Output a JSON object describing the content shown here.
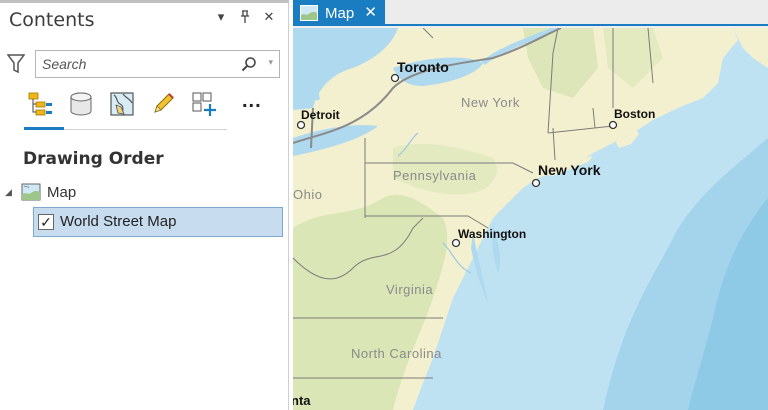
{
  "contents_pane": {
    "title": "Contents",
    "controls": {
      "options_glyph": "▾",
      "pin_glyph": "⊥",
      "close_glyph": "✕"
    },
    "filter_icon": "filter-icon",
    "search": {
      "placeholder": "Search",
      "value": ""
    },
    "toolbar": {
      "tools": [
        "list-by-drawing-order-icon",
        "list-by-data-source-icon",
        "list-by-selection-icon",
        "list-by-editing-icon",
        "list-by-snapping-icon"
      ],
      "more_label": "..."
    },
    "heading": "Drawing Order",
    "tree": {
      "map_label": "Map",
      "layers": [
        {
          "label": "World Street Map",
          "checked": true
        }
      ]
    }
  },
  "map_view": {
    "tab_label": "Map",
    "tab_close": "✕",
    "cities": [
      "Toronto",
      "Detroit",
      "Boston",
      "New York",
      "Washington"
    ],
    "states": [
      "New York",
      "Pennsylvania",
      "Ohio",
      "Virginia",
      "North Carolina"
    ],
    "partial_label": "nta"
  },
  "colors": {
    "accent": "#1a7dc2",
    "land": "#f3f0cf",
    "water": "#aed9ee",
    "deep_water": "#8ec9e6",
    "selection": "#c7dcef"
  }
}
